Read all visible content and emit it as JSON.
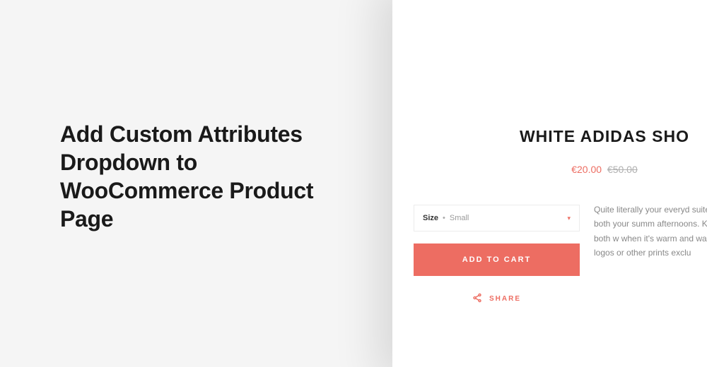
{
  "headline": "Add Custom Attributes Dropdown to WooCommerce Product Page",
  "product": {
    "title": "WHITE ADIDAS SHO",
    "price_sale": "€20.00",
    "price_old": "€50.00",
    "variant_label": "Size",
    "variant_value": "Small",
    "add_to_cart_label": "ADD TO CART",
    "share_label": "SHARE",
    "description": "Quite literally your everyd\nsuited for both your summ\nafternoons. Keeps both w\nwhen it's warm and warm\nlogos or other prints exclu"
  }
}
